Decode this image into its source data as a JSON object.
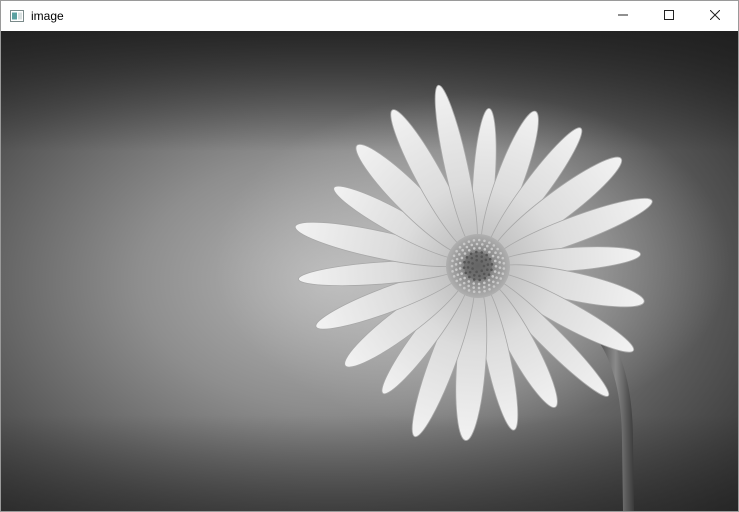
{
  "window": {
    "title": "image",
    "app_icon": "opencv-window-icon",
    "controls": {
      "minimize_icon": "minimize-icon",
      "maximize_icon": "maximize-icon",
      "close_icon": "close-icon"
    }
  },
  "content": {
    "image_subject": "grayscale-daisy-flower-photo"
  },
  "colors": {
    "titlebar_bg": "#ffffff",
    "title_text": "#000000",
    "icon_stroke": "#333333"
  }
}
